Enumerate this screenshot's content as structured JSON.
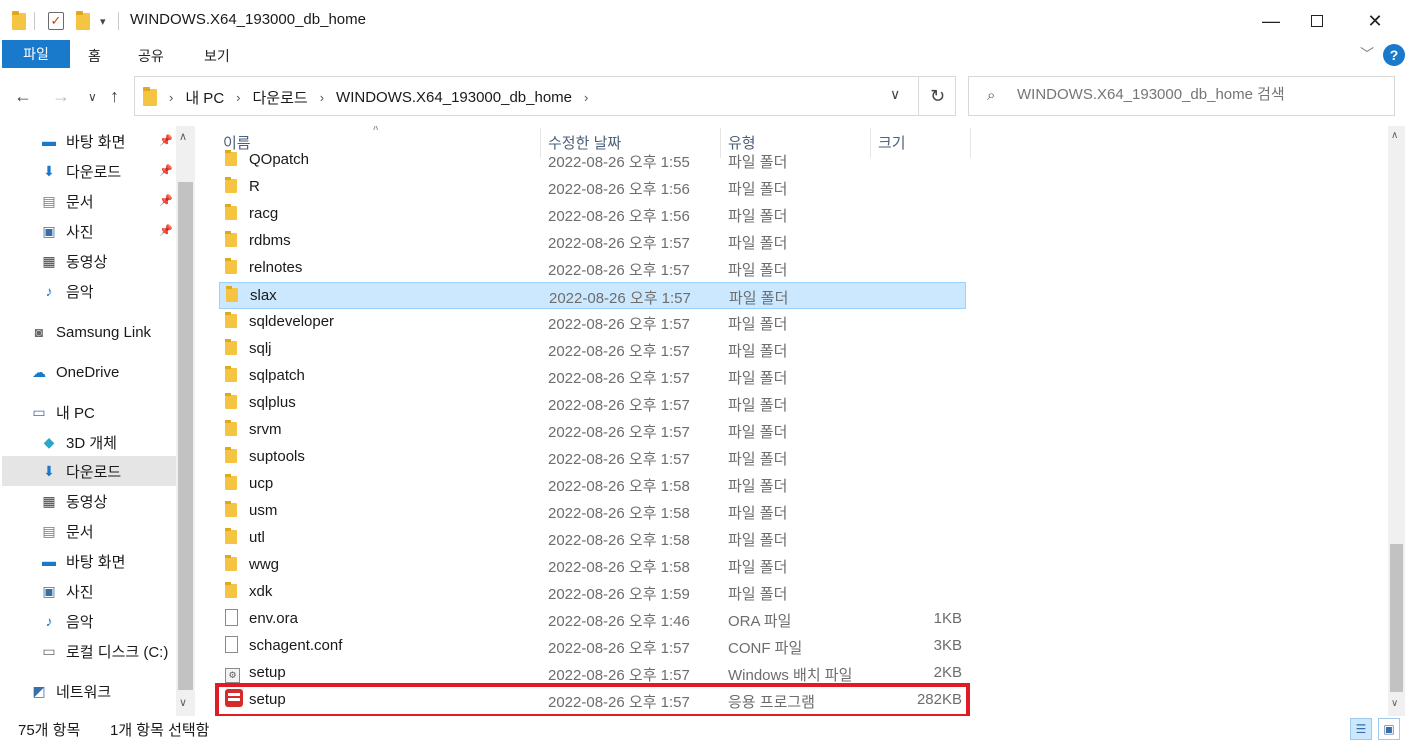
{
  "window": {
    "title": "WINDOWS.X64_193000_db_home",
    "minimize_icon": "minimize-icon",
    "maximize_icon": "maximize-icon",
    "close_icon": "close-icon"
  },
  "ribbon": {
    "tabs": [
      "파일",
      "홈",
      "공유",
      "보기"
    ],
    "help_label": "?"
  },
  "address": {
    "crumbs": [
      "내 PC",
      "다운로드",
      "WINDOWS.X64_193000_db_home"
    ]
  },
  "search": {
    "placeholder": "WINDOWS.X64_193000_db_home 검색"
  },
  "sidebar": {
    "items": [
      {
        "label": "바탕 화면",
        "icon": "desktop-icon",
        "pinned": true
      },
      {
        "label": "다운로드",
        "icon": "download-icon",
        "pinned": true
      },
      {
        "label": "문서",
        "icon": "document-icon",
        "pinned": true
      },
      {
        "label": "사진",
        "icon": "picture-icon",
        "pinned": true
      },
      {
        "label": "동영상",
        "icon": "video-icon",
        "pinned": false
      },
      {
        "label": "음악",
        "icon": "music-icon",
        "pinned": false
      },
      {
        "label": "Samsung Link",
        "icon": "samsung-link-icon",
        "pinned": false
      },
      {
        "label": "OneDrive",
        "icon": "cloud-icon",
        "pinned": false
      },
      {
        "label": "내 PC",
        "icon": "pc-icon",
        "pinned": false
      },
      {
        "label": "3D 개체",
        "icon": "3d-object-icon",
        "pinned": false
      },
      {
        "label": "다운로드",
        "icon": "download-icon",
        "pinned": false,
        "selected": true
      },
      {
        "label": "동영상",
        "icon": "video-icon",
        "pinned": false
      },
      {
        "label": "문서",
        "icon": "document-icon",
        "pinned": false
      },
      {
        "label": "바탕 화면",
        "icon": "desktop-icon",
        "pinned": false
      },
      {
        "label": "사진",
        "icon": "picture-icon",
        "pinned": false
      },
      {
        "label": "음악",
        "icon": "music-icon",
        "pinned": false
      },
      {
        "label": "로컬 디스크 (C:)",
        "icon": "drive-icon",
        "pinned": false
      },
      {
        "label": "네트워크",
        "icon": "network-icon",
        "pinned": false
      }
    ]
  },
  "columns": {
    "name": "이름",
    "date": "수정한 날짜",
    "type": "유형",
    "size": "크기"
  },
  "files": [
    {
      "name": "QOpatch",
      "date": "2022-08-26 오후 1:55",
      "type": "파일 폴더",
      "size": "",
      "icon": "folder-icon"
    },
    {
      "name": "R",
      "date": "2022-08-26 오후 1:56",
      "type": "파일 폴더",
      "size": "",
      "icon": "folder-icon"
    },
    {
      "name": "racg",
      "date": "2022-08-26 오후 1:56",
      "type": "파일 폴더",
      "size": "",
      "icon": "folder-icon"
    },
    {
      "name": "rdbms",
      "date": "2022-08-26 오후 1:57",
      "type": "파일 폴더",
      "size": "",
      "icon": "folder-icon"
    },
    {
      "name": "relnotes",
      "date": "2022-08-26 오후 1:57",
      "type": "파일 폴더",
      "size": "",
      "icon": "folder-icon"
    },
    {
      "name": "slax",
      "date": "2022-08-26 오후 1:57",
      "type": "파일 폴더",
      "size": "",
      "icon": "folder-icon",
      "selected": true
    },
    {
      "name": "sqldeveloper",
      "date": "2022-08-26 오후 1:57",
      "type": "파일 폴더",
      "size": "",
      "icon": "folder-icon"
    },
    {
      "name": "sqlj",
      "date": "2022-08-26 오후 1:57",
      "type": "파일 폴더",
      "size": "",
      "icon": "folder-icon"
    },
    {
      "name": "sqlpatch",
      "date": "2022-08-26 오후 1:57",
      "type": "파일 폴더",
      "size": "",
      "icon": "folder-icon"
    },
    {
      "name": "sqlplus",
      "date": "2022-08-26 오후 1:57",
      "type": "파일 폴더",
      "size": "",
      "icon": "folder-icon"
    },
    {
      "name": "srvm",
      "date": "2022-08-26 오후 1:57",
      "type": "파일 폴더",
      "size": "",
      "icon": "folder-icon"
    },
    {
      "name": "suptools",
      "date": "2022-08-26 오후 1:57",
      "type": "파일 폴더",
      "size": "",
      "icon": "folder-icon"
    },
    {
      "name": "ucp",
      "date": "2022-08-26 오후 1:58",
      "type": "파일 폴더",
      "size": "",
      "icon": "folder-icon"
    },
    {
      "name": "usm",
      "date": "2022-08-26 오후 1:58",
      "type": "파일 폴더",
      "size": "",
      "icon": "folder-icon"
    },
    {
      "name": "utl",
      "date": "2022-08-26 오후 1:58",
      "type": "파일 폴더",
      "size": "",
      "icon": "folder-icon"
    },
    {
      "name": "wwg",
      "date": "2022-08-26 오후 1:58",
      "type": "파일 폴더",
      "size": "",
      "icon": "folder-icon"
    },
    {
      "name": "xdk",
      "date": "2022-08-26 오후 1:59",
      "type": "파일 폴더",
      "size": "",
      "icon": "folder-icon"
    },
    {
      "name": "env.ora",
      "date": "2022-08-26 오후 1:46",
      "type": "ORA 파일",
      "size": "1KB",
      "icon": "file-icon"
    },
    {
      "name": "schagent.conf",
      "date": "2022-08-26 오후 1:57",
      "type": "CONF 파일",
      "size": "3KB",
      "icon": "file-icon"
    },
    {
      "name": "setup",
      "date": "2022-08-26 오후 1:57",
      "type": "Windows 배치 파일",
      "size": "2KB",
      "icon": "batch-file-icon"
    },
    {
      "name": "setup",
      "date": "2022-08-26 오후 1:57",
      "type": "응용 프로그램",
      "size": "282KB",
      "icon": "setup-exe-icon",
      "highlighted": true
    }
  ],
  "status": {
    "item_count": "75개 항목",
    "selection": "1개 항목 선택함"
  },
  "colors": {
    "accent": "#1979ca",
    "selection_bg": "#cce8ff",
    "highlight_box": "#e01b24"
  }
}
